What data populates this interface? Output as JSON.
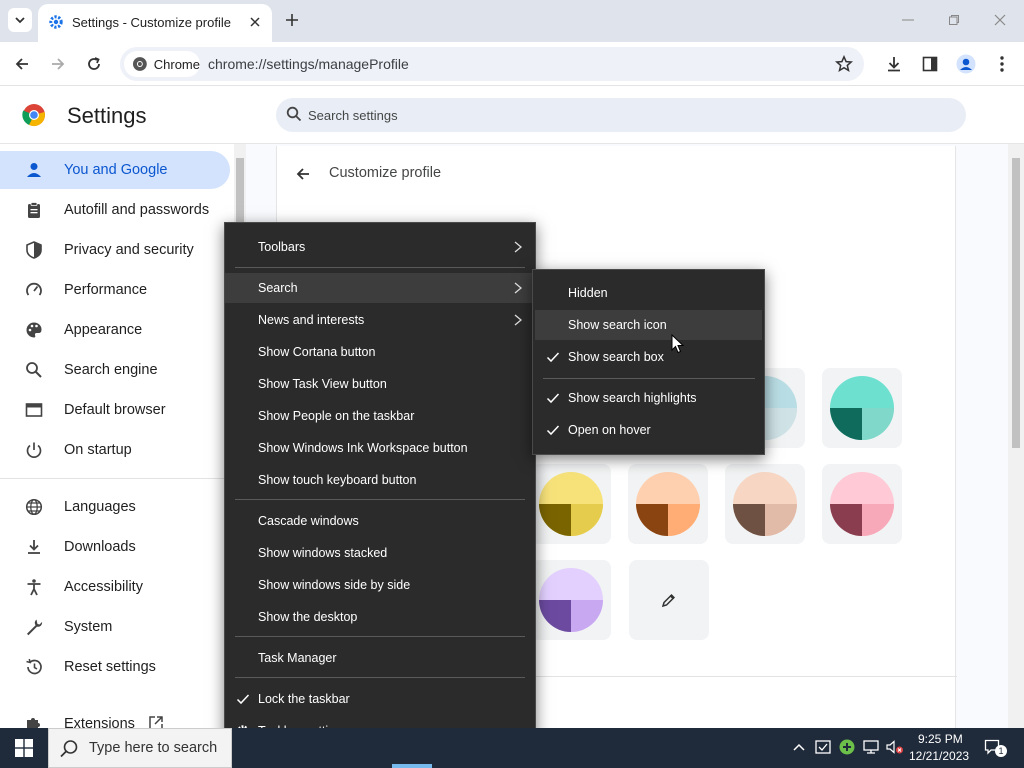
{
  "browser": {
    "tab_title": "Settings - Customize profile",
    "omnibox_chip": "Chrome",
    "url": "chrome://settings/manageProfile"
  },
  "settings": {
    "title": "Settings",
    "search_placeholder": "Search settings",
    "page_title": "Customize profile",
    "sidebar": {
      "items": [
        {
          "label": "You and Google",
          "icon": "person-icon"
        },
        {
          "label": "Autofill and passwords",
          "icon": "clipboard-icon"
        },
        {
          "label": "Privacy and security",
          "icon": "shield-icon"
        },
        {
          "label": "Performance",
          "icon": "speedometer-icon"
        },
        {
          "label": "Appearance",
          "icon": "palette-icon"
        },
        {
          "label": "Search engine",
          "icon": "search-icon"
        },
        {
          "label": "Default browser",
          "icon": "browser-window-icon"
        },
        {
          "label": "On startup",
          "icon": "power-icon"
        },
        {
          "label": "Languages",
          "icon": "globe-icon"
        },
        {
          "label": "Downloads",
          "icon": "download-icon"
        },
        {
          "label": "Accessibility",
          "icon": "accessibility-icon"
        },
        {
          "label": "System",
          "icon": "wrench-icon"
        },
        {
          "label": "Reset settings",
          "icon": "history-icon"
        },
        {
          "label": "Extensions",
          "icon": "puzzle-icon"
        }
      ]
    },
    "color_swatches": [
      {
        "top": "#b9dde4",
        "bl": "#8fb3bd",
        "br": "#cfe2e6"
      },
      {
        "top": "#6ee0d0",
        "bl": "#0f6b5c",
        "br": "#7fd8c9"
      },
      {
        "top": "#f7e27a",
        "bl": "#7a6400",
        "br": "#e6cc4c"
      },
      {
        "top": "#ffd0b0",
        "bl": "#8a4412",
        "br": "#ffad75"
      },
      {
        "top": "#f7d6c4",
        "bl": "#6e5142",
        "br": "#e2bba8"
      },
      {
        "top": "#ffc9d6",
        "bl": "#8a3d4e",
        "br": "#f7a9b9"
      },
      {
        "top": "#e3d0ff",
        "bl": "#6b4aa0",
        "br": "#c9a8f2"
      }
    ]
  },
  "context_menu": {
    "items": [
      {
        "label": "Toolbars",
        "submenu": true
      },
      {
        "label": "Search",
        "submenu": true
      },
      {
        "label": "News and interests",
        "submenu": true
      },
      {
        "label": "Show Cortana button"
      },
      {
        "label": "Show Task View button"
      },
      {
        "label": "Show People on the taskbar"
      },
      {
        "label": "Show Windows Ink Workspace button"
      },
      {
        "label": "Show touch keyboard button"
      },
      {
        "label": "Cascade windows"
      },
      {
        "label": "Show windows stacked"
      },
      {
        "label": "Show windows side by side"
      },
      {
        "label": "Show the desktop"
      },
      {
        "label": "Task Manager"
      },
      {
        "label": "Lock the taskbar",
        "checked": true
      },
      {
        "label": "Taskbar settings",
        "icon": "gear-icon"
      }
    ]
  },
  "search_submenu": {
    "items": [
      {
        "label": "Hidden"
      },
      {
        "label": "Show search icon"
      },
      {
        "label": "Show search box",
        "checked": true
      },
      {
        "label": "Show search highlights",
        "checked": true
      },
      {
        "label": "Open on hover",
        "checked": true
      }
    ]
  },
  "taskbar": {
    "search_placeholder": "Type here to search",
    "clock_time": "9:25 PM",
    "clock_date": "12/21/2023",
    "notification_count": "1"
  },
  "colors": {
    "accent": "#0b57d0",
    "active_nav_bg": "#d3e3fd",
    "menu_bg": "#2b2b2b",
    "taskbar_bg": "#1f2a3a"
  }
}
